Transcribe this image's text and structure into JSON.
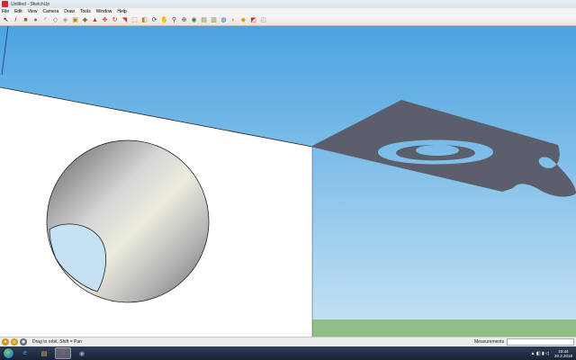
{
  "window": {
    "title": "Untitled - SketchUp"
  },
  "menu": [
    "File",
    "Edit",
    "View",
    "Camera",
    "Draw",
    "Tools",
    "Window",
    "Help"
  ],
  "toolbar": {
    "tools": [
      {
        "name": "select-tool-icon",
        "glyph": "↖",
        "color": "#000000"
      },
      {
        "name": "pencil-tool-icon",
        "glyph": "/",
        "color": "#c0392b"
      },
      {
        "name": "rectangle-tool-icon",
        "glyph": "■",
        "color": "#8a6d3b"
      },
      {
        "name": "circle-tool-icon",
        "glyph": "●",
        "color": "#8a6d3b"
      },
      {
        "name": "arc-tool-icon",
        "glyph": "◜",
        "color": "#555555"
      },
      {
        "name": "eraser-tool-icon",
        "glyph": "◇",
        "color": "#777777"
      },
      {
        "name": "make-component-icon",
        "glyph": "◈",
        "color": "#999999"
      },
      {
        "name": "paint-bucket-icon",
        "glyph": "▣",
        "color": "#b8860b"
      },
      {
        "name": "tape-measure-icon",
        "glyph": "◆",
        "color": "#8a6d3b"
      },
      {
        "name": "push-pull-icon",
        "glyph": "▲",
        "color": "#c0392b"
      },
      {
        "name": "move-tool-icon",
        "glyph": "✥",
        "color": "#c0392b"
      },
      {
        "name": "rotate-tool-icon",
        "glyph": "↻",
        "color": "#c0392b"
      },
      {
        "name": "follow-me-icon",
        "glyph": "◥",
        "color": "#c0392b"
      },
      {
        "name": "scale-tool-icon",
        "glyph": "⬚",
        "color": "#c0392b"
      },
      {
        "name": "offset-tool-icon",
        "glyph": "◧",
        "color": "#b8860b"
      },
      {
        "name": "orbit-tool-icon",
        "glyph": "⟳",
        "color": "#444444"
      },
      {
        "name": "pan-tool-icon",
        "glyph": "✋",
        "color": "#444444"
      },
      {
        "name": "zoom-tool-icon",
        "glyph": "⚲",
        "color": "#444444"
      },
      {
        "name": "zoom-extents-icon",
        "glyph": "⊕",
        "color": "#444444"
      },
      {
        "name": "add-location-icon",
        "glyph": "◉",
        "color": "#2e7d32"
      },
      {
        "name": "toggle-terrain-icon",
        "glyph": "▤",
        "color": "#6d8f3b"
      },
      {
        "name": "photo-textures-icon",
        "glyph": "▥",
        "color": "#6d8f3b"
      },
      {
        "name": "get-models-icon",
        "glyph": "◍",
        "color": "#1565c0"
      },
      {
        "name": "share-model-icon",
        "glyph": "◐",
        "color": "#d4a017"
      },
      {
        "name": "share-component-icon",
        "glyph": "◆",
        "color": "#d4a017"
      },
      {
        "name": "extension-warehouse-icon",
        "glyph": "◩",
        "color": "#c0392b"
      },
      {
        "name": "send-to-layout-icon",
        "glyph": "◰",
        "color": "#999999"
      }
    ]
  },
  "scene": {
    "sky_top": "#4aa3e0",
    "sky_bottom": "#c8e3f5",
    "ground": "#8fbf86",
    "wall_color": "#ffffff",
    "shadow_color": "#5b5f6b"
  },
  "status": {
    "hint": "Drag to orbit.  Shift = Pan",
    "measurements_label": "Measurements",
    "measurements_value": ""
  },
  "taskbar": {
    "apps": [
      {
        "name": "ie-taskbar-icon",
        "glyph": "e",
        "color": "#3fa9f5",
        "active": false
      },
      {
        "name": "explorer-taskbar-icon",
        "glyph": "▤",
        "color": "#f0c040",
        "active": false
      },
      {
        "name": "sketchup-taskbar-icon",
        "glyph": "S",
        "color": "#e0442e",
        "active": true
      },
      {
        "name": "app-taskbar-icon",
        "glyph": "◉",
        "color": "#9aa9b8",
        "active": false
      }
    ],
    "tray_icons": "▲ ◧ ▮ ◁",
    "time": "19:44",
    "date": "20.2.2018"
  }
}
